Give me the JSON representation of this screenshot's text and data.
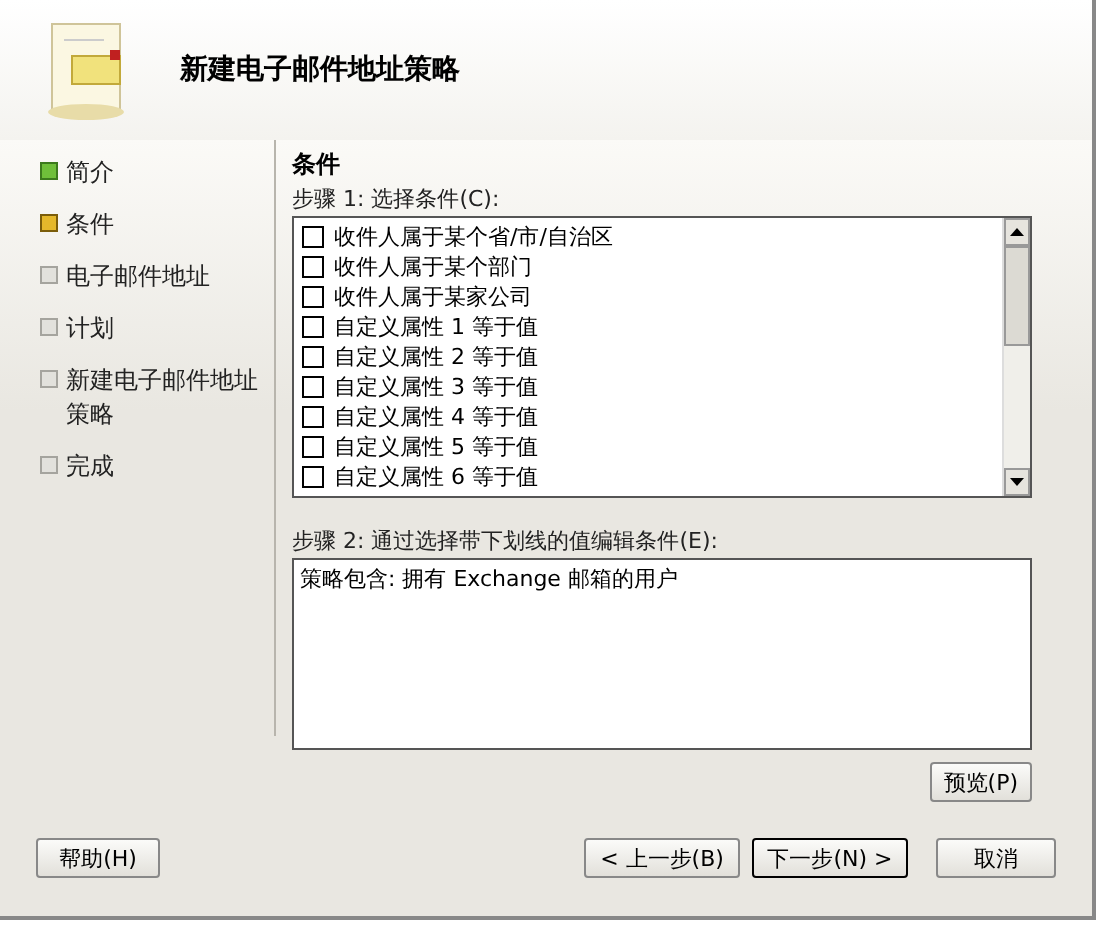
{
  "header": {
    "title": "新建电子邮件地址策略"
  },
  "steps": [
    {
      "label": "简介",
      "kind": "done"
    },
    {
      "label": "条件",
      "kind": "current"
    },
    {
      "label": "电子邮件地址",
      "kind": "pending"
    },
    {
      "label": "计划",
      "kind": "pending"
    },
    {
      "label": "新建电子邮件地址策略",
      "kind": "pending"
    },
    {
      "label": "完成",
      "kind": "pending"
    }
  ],
  "section_title": "条件",
  "step1_label": "步骤 1: 选择条件(C):",
  "conditions": [
    {
      "label": "收件人属于某个省/市/自治区",
      "checked": false
    },
    {
      "label": "收件人属于某个部门",
      "checked": false
    },
    {
      "label": "收件人属于某家公司",
      "checked": false
    },
    {
      "label": "自定义属性 1 等于值",
      "checked": false
    },
    {
      "label": "自定义属性 2 等于值",
      "checked": false
    },
    {
      "label": "自定义属性 3 等于值",
      "checked": false
    },
    {
      "label": "自定义属性 4 等于值",
      "checked": false
    },
    {
      "label": "自定义属性 5 等于值",
      "checked": false
    },
    {
      "label": "自定义属性 6 等于值",
      "checked": false
    }
  ],
  "step2_label": "步骤 2: 通过选择带下划线的值编辑条件(E):",
  "step2_text": "策略包含: 拥有 Exchange 邮箱的用户",
  "preview_button": "预览(P)",
  "help_button": "帮助(H)",
  "back_button": "< 上一步(B)",
  "next_button": "下一步(N) >",
  "cancel_button": "取消"
}
